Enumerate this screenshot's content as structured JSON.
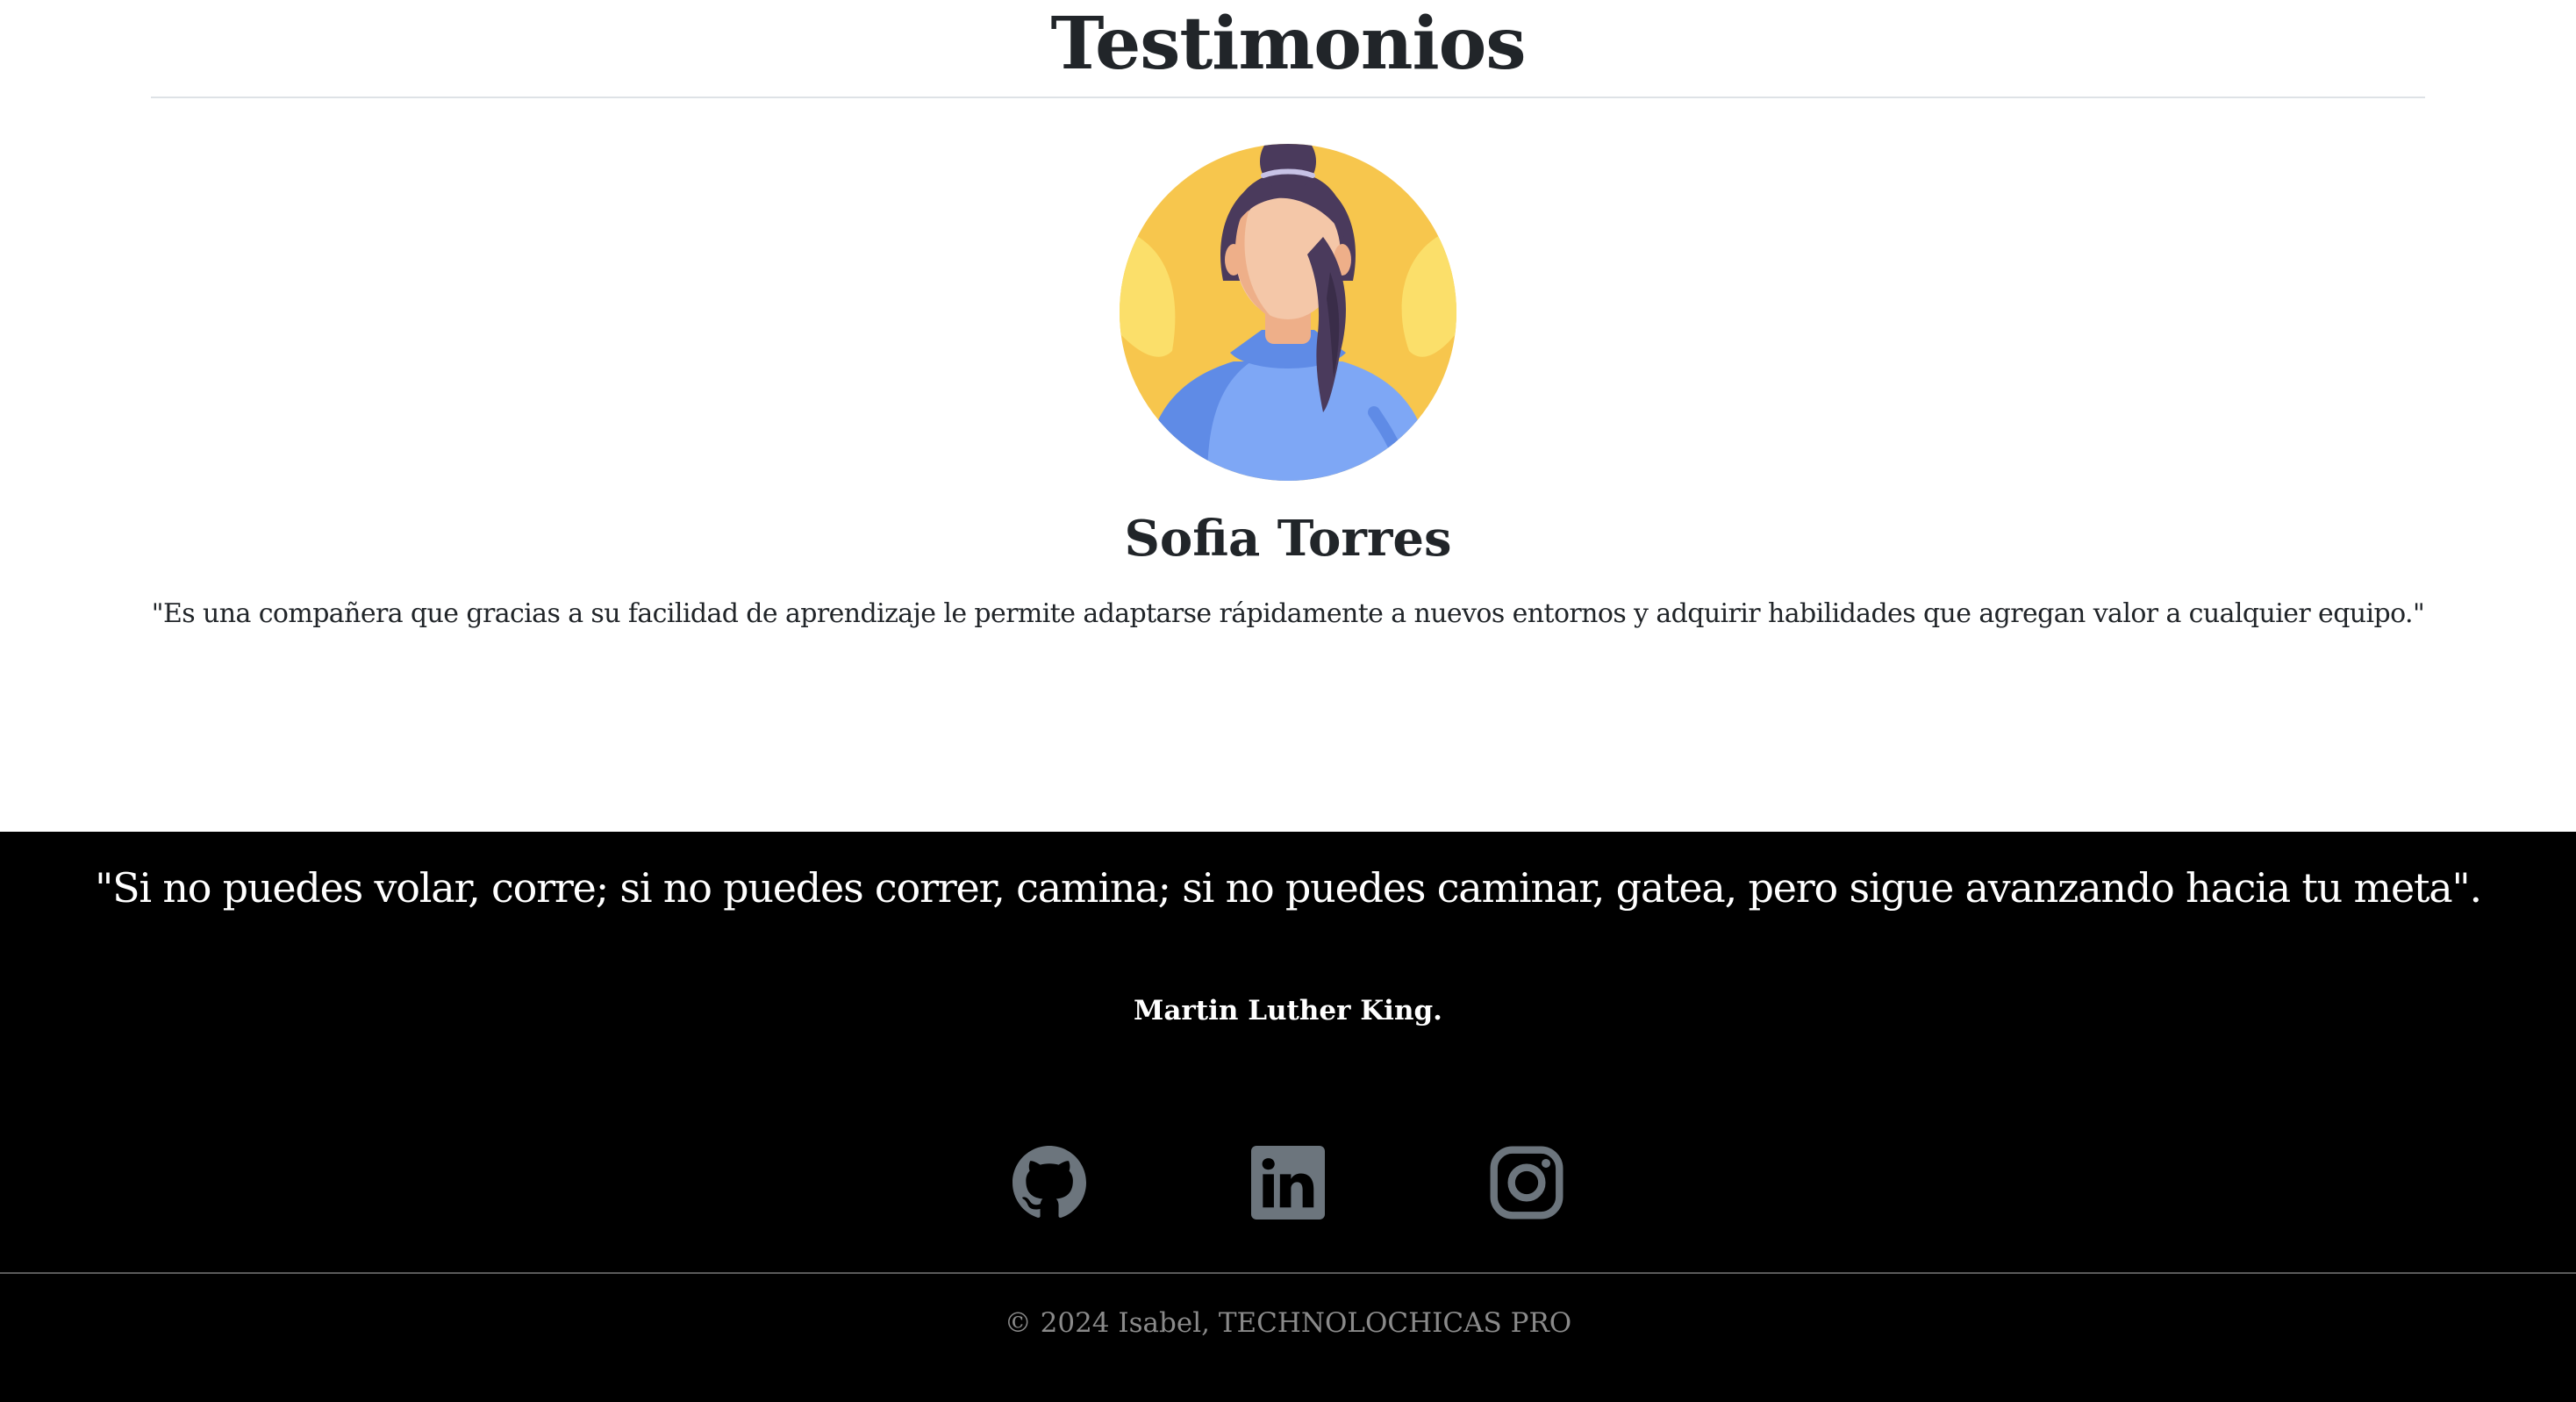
{
  "testimonials": {
    "title": "Testimonios",
    "person": {
      "name": "Sofia Torres",
      "text": "\"Es una compañera que gracias a su facilidad de aprendizaje le permite adaptarse rápidamente a nuevos entornos y adquirir habilidades que agregan valor a cualquier equipo.\"",
      "avatar_icon": "woman-avatar-icon"
    }
  },
  "footer": {
    "quote": "\"Si no puedes volar, corre; si no puedes correr, camina; si no puedes caminar, gatea, pero sigue avanzando hacia tu meta\".",
    "quote_author": "Martin Luther King.",
    "social": [
      {
        "icon": "github-icon"
      },
      {
        "icon": "linkedin-icon"
      },
      {
        "icon": "instagram-icon"
      }
    ],
    "copyright": "© 2024 Isabel, TECHNOLOCHICAS PRO",
    "colors": {
      "background": "#000000",
      "icon": "#6c757d",
      "text": "#ffffff",
      "muted_text": "#8a8a8a"
    }
  }
}
